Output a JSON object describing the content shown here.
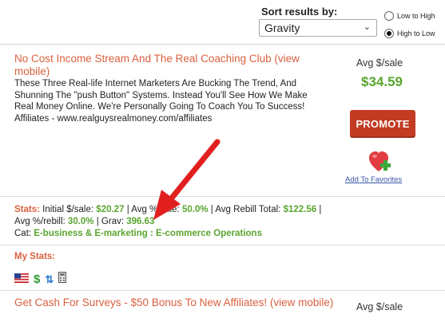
{
  "sort": {
    "label": "Sort results by:",
    "selected": "Gravity",
    "options": [
      {
        "label": "Low to High",
        "checked": false
      },
      {
        "label": "High to Low",
        "checked": true
      }
    ]
  },
  "listings": [
    {
      "title": "No Cost Income Stream And The Real Coaching Club (view mobile)",
      "description": "These Three Real-life Internet Marketers Are Bucking The Trend, And Shunning The \"push Button\" Systems. Instead You'll See How We Make Real Money Online. We're Personally Going To Coach You To Success! Affiliates - www.realguysrealmoney.com/affiliates",
      "avg_label": "Avg $/sale",
      "avg_value": "$34.59",
      "promote_label": "PROMOTE",
      "favorites_label": "Add To Favorites",
      "stats": {
        "label": "Stats:",
        "initial_label": "Initial $/sale:",
        "initial_value": "$20.27",
        "avg_sale_label": "| Avg %/sale:",
        "avg_sale_value": "50.0%",
        "rebill_total_label": "| Avg Rebill Total:",
        "rebill_total_value": "$122.56",
        "pipe": "|",
        "rebill_pct_label": "Avg %/rebill:",
        "rebill_pct_value": "30.0%",
        "grav_label": "| Grav:",
        "grav_value": "396.63",
        "cat_label": "Cat:",
        "cat_value": "E-business & E-marketing : E-commerce Operations"
      },
      "mystats_label": "My Stats:",
      "icons": [
        "us-flag-icon",
        "dollar-icon",
        "rebill-icon",
        "calculator-icon"
      ]
    },
    {
      "title": "Get Cash For Surveys - $50 Bonus To New Affiliates! (view mobile)",
      "avg_label": "Avg $/sale"
    }
  ]
}
